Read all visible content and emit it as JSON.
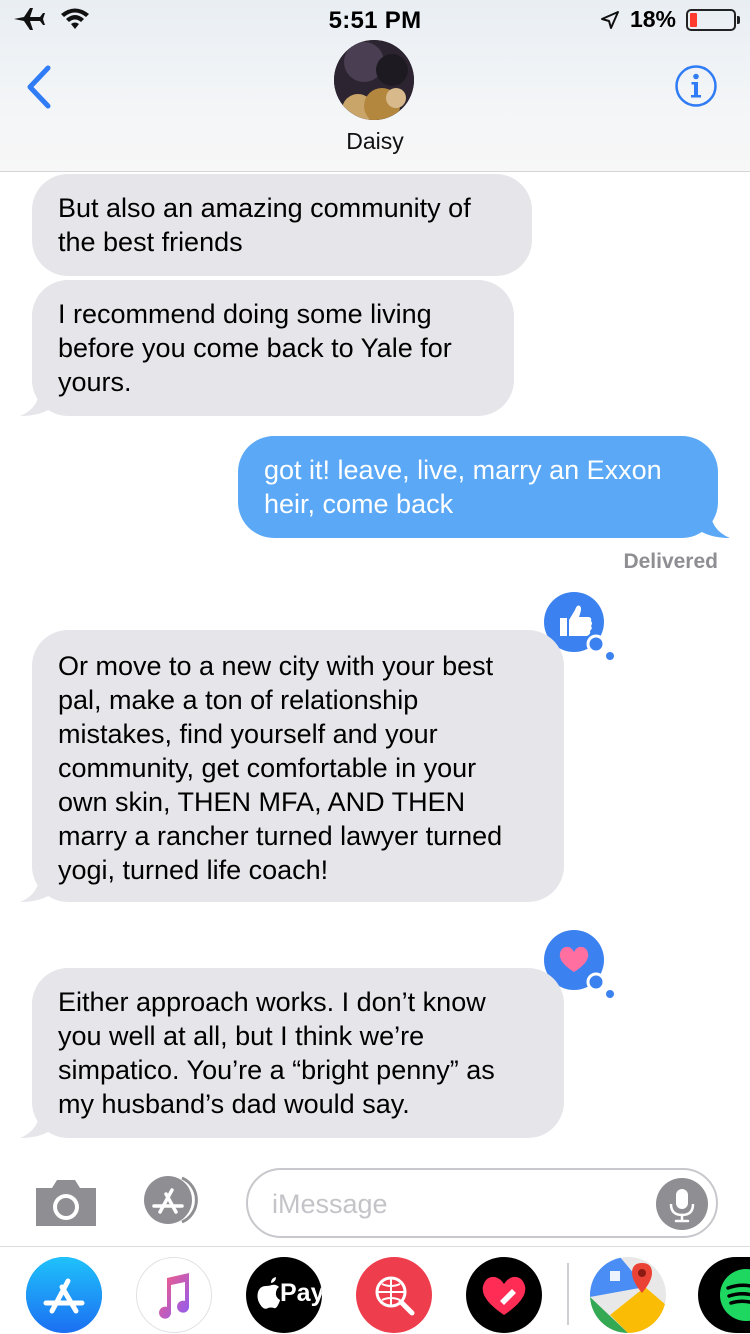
{
  "status_bar": {
    "time": "5:51 PM",
    "battery_percent": "18%",
    "battery_level": 0.18
  },
  "header": {
    "contact_name": "Daisy"
  },
  "messages": [
    {
      "direction": "incoming",
      "text": "But also an amazing community of\nthe best friends"
    },
    {
      "direction": "incoming",
      "text": "I recommend doing some living\nbefore you come back to Yale for\nyours."
    },
    {
      "direction": "outgoing",
      "text": "got it! leave, live, marry an Exxon\nheir, come back"
    },
    {
      "direction": "incoming",
      "text": "Or move to a new city with your best\npal, make a ton of relationship\nmistakes, find yourself and your\ncommunity, get comfortable in your\nown skin, THEN MFA, AND THEN\nmarry a rancher turned lawyer turned\nyogi, turned life coach!",
      "tapback": "thumbs-up"
    },
    {
      "direction": "incoming",
      "text": "Either approach works. I don’t know\nyou well at all, but I think we’re\nsimpatico. You’re a “bright penny” as\nmy husband’s dad would say.",
      "tapback": "heart"
    }
  ],
  "delivered_label": "Delivered",
  "input": {
    "placeholder": "iMessage",
    "value": ""
  },
  "app_drawer": {
    "apps": [
      "app-store",
      "music",
      "apple-pay",
      "search-images",
      "digital-touch",
      "google-maps",
      "spotify"
    ],
    "apple_pay_label": "Pay"
  },
  "colors": {
    "incoming_bubble": "#e5e5ea",
    "outgoing_bubble": "#5aa8f6",
    "accent": "#2f7cf6",
    "tapback_bubble": "#3b82f0"
  }
}
